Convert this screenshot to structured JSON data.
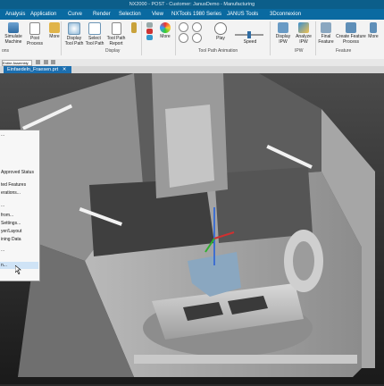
{
  "window": {
    "title": "NX2000 - POST - Customer: JanusDemo - Manufacturing"
  },
  "menu": {
    "items": [
      "Analysis",
      "Application",
      "Curve",
      "Render",
      "Selection",
      "View",
      "NXTools 1980 Series",
      "JANUS Tools",
      "3Dconnexion"
    ]
  },
  "ribbon": {
    "buttons": {
      "simulate": "Simulate\nMachine",
      "post": "Post\nProcess",
      "more1": "More",
      "display_tool_path": "Display\nTool Path",
      "select_tool_path": "Select\nTool Path",
      "tool_path_report": "Tool Path\nReport",
      "more2": "More",
      "play": "Play",
      "speed": "Speed",
      "display_ipw": "Display\nIPW",
      "analyze_ipw": "Analyze\nIPW",
      "final_feature": "Final\nFeature",
      "create_feature_process": "Create Feature\nProcess",
      "more3": "More"
    },
    "groups": {
      "operations": "ons",
      "display": "Display",
      "animation": "Tool Path Animation",
      "ipw": "IPW",
      "feature": "Feature"
    }
  },
  "quickbar": {
    "filter_value": "Entire Assembly"
  },
  "tabs": [
    {
      "label": "Einfaedeln_Fraesen.prt"
    }
  ],
  "context_menu": {
    "items": [
      "...",
      "Approved Status",
      "ted Features",
      "erations...",
      "...",
      "from...",
      "Settings...",
      "yer/Layout",
      "ining Data",
      "...",
      "n..."
    ],
    "selected_index": 10
  },
  "colors": {
    "accent": "#0a6aa1",
    "ribbon_bg": "#f3f3f3",
    "viewport_top": "#4b4b4b",
    "viewport_bottom": "#1a1a1a",
    "tool_head": "#8aa7c0"
  },
  "icons": [
    "simulate-icon",
    "post-icon",
    "tool-path-icon",
    "play-icon",
    "ipw-icon",
    "feature-icon",
    "pin-icon",
    "close-icon"
  ]
}
